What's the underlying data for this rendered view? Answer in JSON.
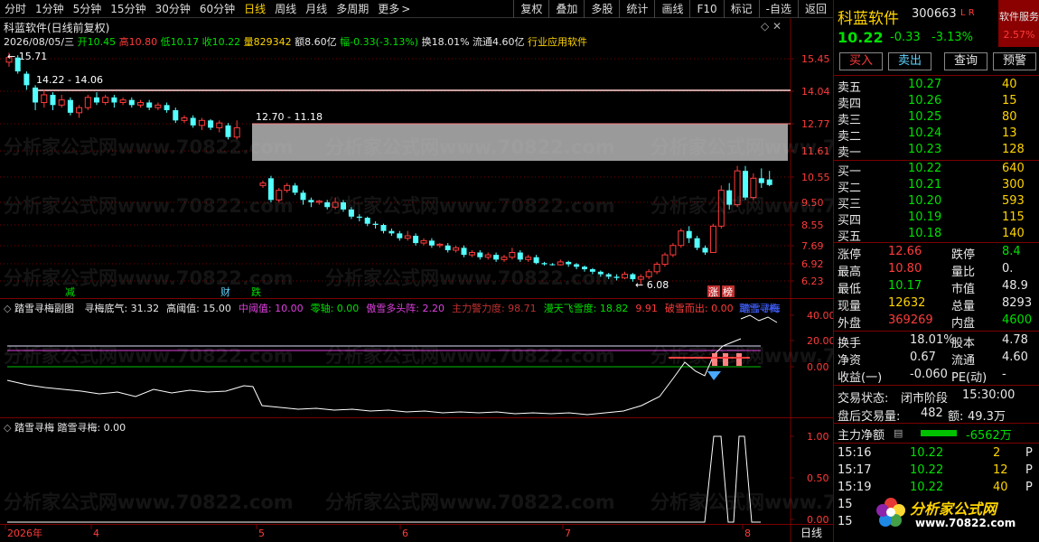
{
  "toolbar": {
    "periods": [
      "分时",
      "1分钟",
      "5分钟",
      "15分钟",
      "30分钟",
      "60分钟",
      "日线",
      "周线",
      "月线",
      "多周期",
      "更多"
    ],
    "active_index": 6,
    "more_arrow": ">",
    "right_items": [
      "复权",
      "叠加",
      "多股",
      "统计",
      "画线",
      "F10",
      "标记",
      "-自选",
      "返回"
    ]
  },
  "main": {
    "title": "科蓝软件(日线前复权)",
    "ctrl_icons": "◇ ✕",
    "info": {
      "date": "2026/08/05/三",
      "open_label": "开",
      "open": "10.45",
      "high_label": "高",
      "high": "10.80",
      "low_label": "低",
      "low": "10.17",
      "close_label": "收",
      "close": "10.22",
      "vol_label": "量",
      "vol": "829342",
      "amt_label": "额",
      "amt": "8.60亿",
      "chg_label": "幅",
      "chg": "-0.33(-3.13%)",
      "turn_label": "换",
      "turn": "18.01%",
      "float_label": "流通",
      "float": "4.60亿",
      "industry": "行业应用软件"
    },
    "price_axis": [
      "15.45",
      "14.04",
      "12.77",
      "11.61",
      "10.55",
      "9.50",
      "8.55",
      "7.69",
      "6.92",
      "6.23"
    ],
    "annotations": {
      "top_price": "15.71",
      "range1": "14.22 - 14.06",
      "range2": "12.70 - 11.18",
      "low_price": "6.08"
    },
    "markers": [
      "减",
      "财",
      "跌",
      "涨",
      "榜"
    ]
  },
  "sub1": {
    "title": "踏雪寻梅副图",
    "params": [
      {
        "label": "寻梅底气: 31.32",
        "color": "#e8e8e8"
      },
      {
        "label": "高阈值: 15.00",
        "color": "#e8e8e8"
      },
      {
        "label": "中阈值: 10.00",
        "color": "#e040e0"
      },
      {
        "label": "零轴: 0.00",
        "color": "#00e000"
      },
      {
        "label": "傲雪多头阵: 2.20",
        "color": "#e040e0"
      },
      {
        "label": "主力警力度: 98.71",
        "color": "#c03030"
      },
      {
        "label": "漫天飞雪度: 18.82",
        "color": "#00e000"
      },
      {
        "label": "9.91",
        "color": "#ff3b3b"
      },
      {
        "label": "破雪而出: 0.00",
        "color": "#ff3b3b"
      },
      {
        "label": "踏雪寻梅",
        "color": "#4060ff"
      }
    ],
    "axis": [
      "40.00",
      "20.00",
      "0.00"
    ],
    "peak_label": "踏雪寻梅"
  },
  "sub2": {
    "title": "踏雪寻梅",
    "value": "踏雪寻梅: 0.00",
    "axis": [
      "1.00",
      "0.50",
      "0.00"
    ]
  },
  "xaxis": {
    "labels": [
      "2026年",
      "4",
      "5",
      "6",
      "7",
      "8"
    ],
    "mode": "日线"
  },
  "watermark": "分析家公式网www.70822.com",
  "quote": {
    "name": "科蓝软件",
    "code": "300663",
    "flags": "L R",
    "badge": "软件服务",
    "badge_pct": "2.57%",
    "price": "10.22",
    "change": "-0.33",
    "change_pct": "-3.13%",
    "buttons": [
      "买入",
      "卖出",
      "查询",
      "预警"
    ],
    "asks": [
      {
        "label": "卖五",
        "price": "10.27",
        "vol": "40"
      },
      {
        "label": "卖四",
        "price": "10.26",
        "vol": "15"
      },
      {
        "label": "卖三",
        "price": "10.25",
        "vol": "80"
      },
      {
        "label": "卖二",
        "price": "10.24",
        "vol": "13"
      },
      {
        "label": "卖一",
        "price": "10.23",
        "vol": "128"
      }
    ],
    "bids": [
      {
        "label": "买一",
        "price": "10.22",
        "vol": "640"
      },
      {
        "label": "买二",
        "price": "10.21",
        "vol": "300"
      },
      {
        "label": "买三",
        "price": "10.20",
        "vol": "593"
      },
      {
        "label": "买四",
        "price": "10.19",
        "vol": "115"
      },
      {
        "label": "买五",
        "price": "10.18",
        "vol": "140"
      }
    ],
    "stats": [
      {
        "l1": "涨停",
        "v1": "12.66",
        "c1": "#ff3b3b",
        "l2": "跌停",
        "v2": "8.4",
        "c2": "#00e000"
      },
      {
        "l1": "最高",
        "v1": "10.80",
        "c1": "#ff3b3b",
        "l2": "量比",
        "v2": "0.",
        "c2": "#e8e8e8"
      },
      {
        "l1": "最低",
        "v1": "10.17",
        "c1": "#00e000",
        "l2": "市值",
        "v2": "48.9",
        "c2": "#e8e8e8"
      },
      {
        "l1": "现量",
        "v1": "12632",
        "c1": "#ffd400",
        "l2": "总量",
        "v2": "8293",
        "c2": "#e8e8e8"
      },
      {
        "l1": "外盘",
        "v1": "369269",
        "c1": "#ff3b3b",
        "l2": "内盘",
        "v2": "4600",
        "c2": "#00e000"
      }
    ],
    "stats2": [
      {
        "l1": "换手",
        "v1": "18.01%",
        "l2": "股本",
        "v2": "4.78"
      },
      {
        "l1": "净资",
        "v1": "0.67",
        "l2": "流通",
        "v2": "4.60"
      },
      {
        "l1": "收益(一)",
        "v1": "-0.060",
        "l2": "PE(动)",
        "v2": "-"
      }
    ],
    "trade_status_label": "交易状态:",
    "trade_status": "闭市阶段",
    "trade_time": "15:30:00",
    "after_label": "盘后交易量:",
    "after_vol": "482",
    "after_amt_label": "额:",
    "after_amt": "49.3万",
    "net_label": "主力净额",
    "net_value": "-6562万",
    "ticks": [
      {
        "time": "15:16",
        "price": "10.22",
        "vol": "2",
        "flag": "P"
      },
      {
        "time": "15:17",
        "price": "10.22",
        "vol": "12",
        "flag": "P"
      },
      {
        "time": "15:19",
        "price": "10.22",
        "vol": "40",
        "flag": "P"
      },
      {
        "time": "15",
        "price": "",
        "vol": "",
        "flag": ""
      },
      {
        "time": "15",
        "price": "",
        "vol": "",
        "flag": ""
      }
    ],
    "logo_text": "分析家公式网",
    "logo_url": "www.70822.com"
  },
  "colors": {
    "up": "#ff3b3b",
    "down": "#54ffff",
    "grid": "#7a0000",
    "band_gray": "#9a9a9a"
  }
}
